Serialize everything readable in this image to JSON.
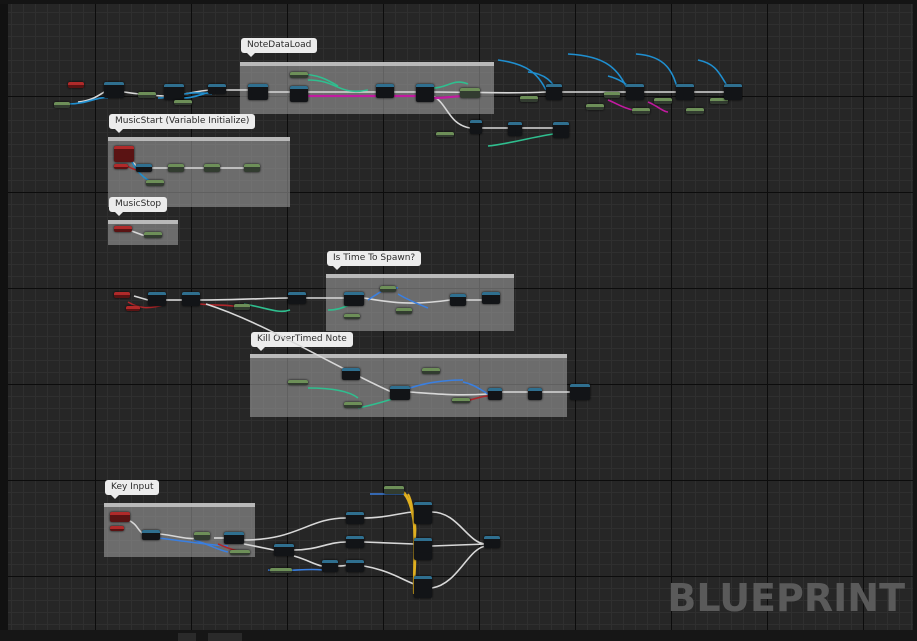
{
  "editor": {
    "watermark": "BLUEPRINT"
  },
  "comments": [
    {
      "id": "notedataload",
      "label": "NoteDataLoad"
    },
    {
      "id": "musicstart",
      "label": "MusicStart (Variable Initialize)"
    },
    {
      "id": "musicstop",
      "label": "MusicStop"
    },
    {
      "id": "istimetospawn",
      "label": "Is Time To Spawn?"
    },
    {
      "id": "killovertimednote",
      "label": "Kill OverTimed Note"
    },
    {
      "id": "keyinput",
      "label": "Key Input"
    }
  ],
  "colors": {
    "exec_wire": "#d8d8d8",
    "object_wire": "#1f8fd0",
    "struct_wire": "#2fbf8f",
    "array_wire": "#c21aa0",
    "bool_wire": "#b0262a",
    "float_wire": "#3a7fe0",
    "key_wire": "#e0b020",
    "canvas": "#262626"
  }
}
